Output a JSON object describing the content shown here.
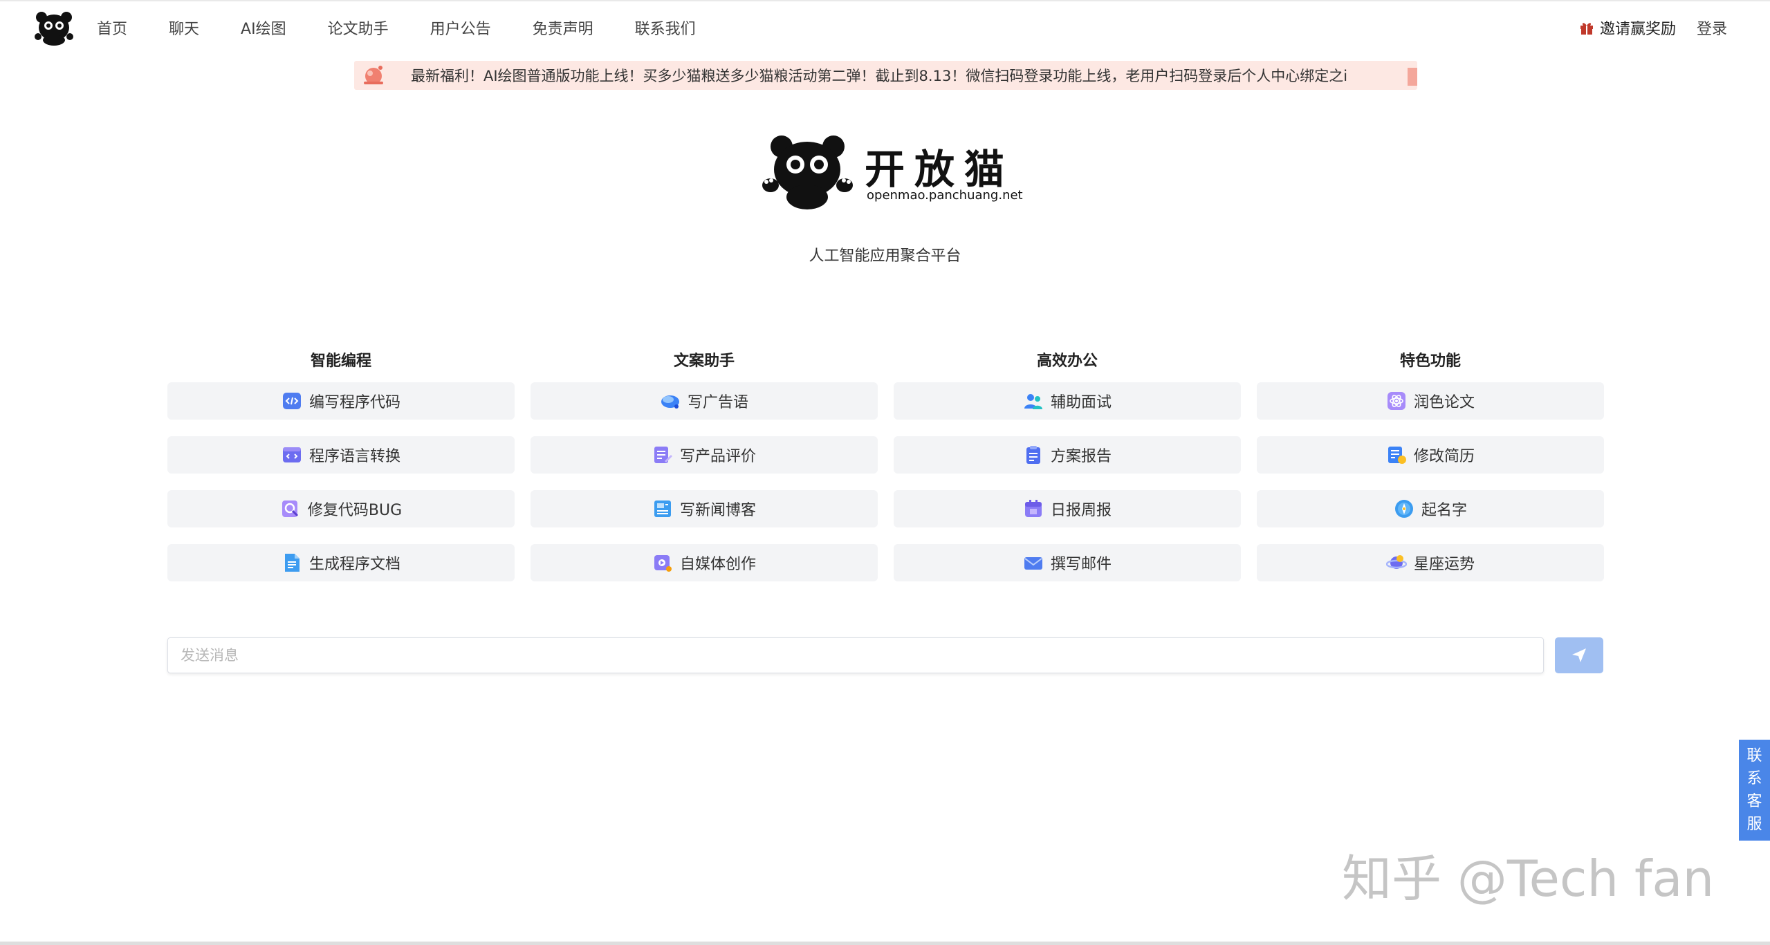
{
  "nav": {
    "items": [
      {
        "label": "首页"
      },
      {
        "label": "聊天"
      },
      {
        "label": "AI绘图"
      },
      {
        "label": "论文助手"
      },
      {
        "label": "用户公告"
      },
      {
        "label": "免责声明"
      },
      {
        "label": "联系我们"
      }
    ],
    "invite_label": "邀请赢奖励",
    "login_label": "登录"
  },
  "notice": {
    "text": "最新福利！AI绘图普通版功能上线！买多少猫粮送多少猫粮活动第二弹！截止到8.13！微信扫码登录功能上线，老用户扫码登录后个人中心绑定之i"
  },
  "hero": {
    "title": "开放猫",
    "domain": "openmao.panchuang.net",
    "subtitle": "人工智能应用聚合平台"
  },
  "columns": [
    {
      "title": "智能编程",
      "items": [
        {
          "label": "编写程序代码",
          "icon": "code-icon"
        },
        {
          "label": "程序语言转换",
          "icon": "code-window-icon"
        },
        {
          "label": "修复代码BUG",
          "icon": "bug-search-icon"
        },
        {
          "label": "生成程序文档",
          "icon": "document-icon"
        }
      ]
    },
    {
      "title": "文案助手",
      "items": [
        {
          "label": "写广告语",
          "icon": "megaphone-icon"
        },
        {
          "label": "写产品评价",
          "icon": "review-icon"
        },
        {
          "label": "写新闻博客",
          "icon": "news-icon"
        },
        {
          "label": "自媒体创作",
          "icon": "media-icon"
        }
      ]
    },
    {
      "title": "高效办公",
      "items": [
        {
          "label": "辅助面试",
          "icon": "interview-icon"
        },
        {
          "label": "方案报告",
          "icon": "clipboard-icon"
        },
        {
          "label": "日报周报",
          "icon": "calendar-icon"
        },
        {
          "label": "撰写邮件",
          "icon": "mail-icon"
        }
      ]
    },
    {
      "title": "特色功能",
      "items": [
        {
          "label": "润色论文",
          "icon": "atom-icon"
        },
        {
          "label": "修改简历",
          "icon": "resume-icon"
        },
        {
          "label": "起名字",
          "icon": "compass-icon"
        },
        {
          "label": "星座运势",
          "icon": "planet-icon"
        }
      ]
    }
  ],
  "composer": {
    "placeholder": "发送消息",
    "value": ""
  },
  "contact": {
    "chars": [
      "联",
      "系",
      "客",
      "服"
    ]
  },
  "watermark": "知乎 @Tech fan",
  "colors": {
    "accent": "#4a86e8",
    "send_button": "#a0bff2",
    "notice_bg": "#fde8e3",
    "card_bg": "#f3f4f6"
  }
}
